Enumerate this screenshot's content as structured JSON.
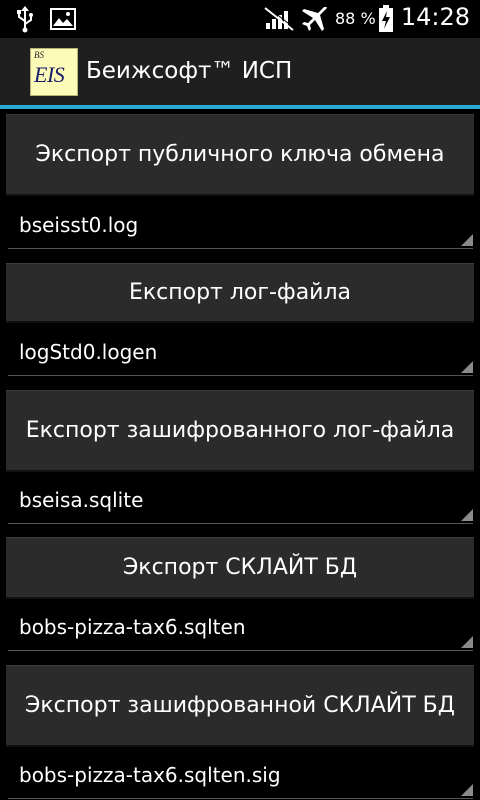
{
  "status_bar": {
    "battery_percent": "88 %",
    "time": "14:28",
    "icons": [
      "usb-icon",
      "image-icon",
      "no-signal-icon",
      "airplane-mode-icon",
      "battery-charging-icon"
    ]
  },
  "action_bar": {
    "app_logo_text_small": "BS",
    "app_logo_text_large": "EIS",
    "title": "Беижсофт™ ИСП"
  },
  "content": {
    "items": [
      {
        "type": "button",
        "label": "Экспорт публичного ключа обмена"
      },
      {
        "type": "spinner",
        "value": "bseisst0.log"
      },
      {
        "type": "button",
        "label": "Експорт лог-файла"
      },
      {
        "type": "spinner",
        "value": "logStd0.logen"
      },
      {
        "type": "button",
        "label": "Експорт зашифрованного лог-файла"
      },
      {
        "type": "spinner",
        "value": "bseisa.sqlite"
      },
      {
        "type": "button",
        "label": "Экспорт СКЛАЙТ БД"
      },
      {
        "type": "spinner",
        "value": "bobs-pizza-tax6.sqlten"
      },
      {
        "type": "button",
        "label": "Экспорт зашифрованной СКЛАЙТ БД"
      },
      {
        "type": "spinner",
        "value": "bobs-pizza-tax6.sqlten.sig"
      }
    ]
  },
  "colors": {
    "accent": "#2ba7d4",
    "button_bg": "#2b2b2b",
    "action_bar_bg": "#1f1f1f",
    "logo_bg": "#fdfbb8"
  }
}
